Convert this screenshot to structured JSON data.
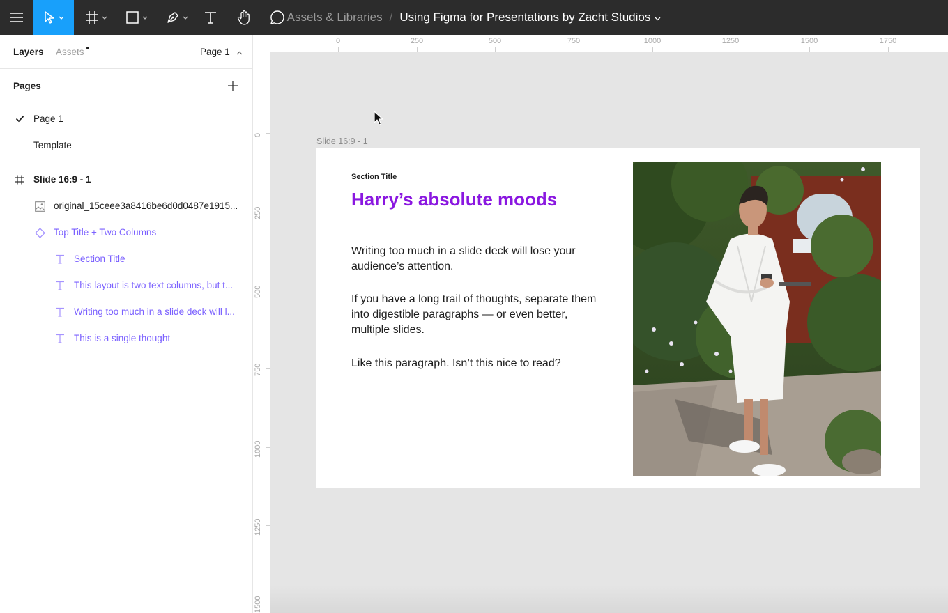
{
  "toolbar": {
    "tools": [
      {
        "name": "main-menu",
        "icon": "hamburger-icon"
      },
      {
        "name": "move-tool",
        "icon": "cursor-icon",
        "active": true
      },
      {
        "name": "frame-tool",
        "icon": "frame-icon"
      },
      {
        "name": "shape-tool",
        "icon": "rectangle-icon"
      },
      {
        "name": "pen-tool",
        "icon": "pen-icon"
      },
      {
        "name": "text-tool",
        "icon": "text-icon"
      },
      {
        "name": "hand-tool",
        "icon": "hand-icon"
      },
      {
        "name": "comment-tool",
        "icon": "comment-icon"
      }
    ],
    "breadcrumb": {
      "parent": "Assets & Libraries",
      "separator": "/",
      "file": "Using Figma for Presentations by Zacht Studios"
    }
  },
  "left_panel": {
    "tabs": {
      "layers": "Layers",
      "assets": "Assets"
    },
    "page_select": "Page 1",
    "pages_title": "Pages",
    "pages": [
      {
        "label": "Page 1",
        "selected": true
      },
      {
        "label": "Template",
        "selected": false
      }
    ],
    "layers": [
      {
        "label": "Slide 16:9 - 1",
        "icon": "frame-icon"
      },
      {
        "label": "original_15ceee3a8416be6d0d0487e1915...",
        "icon": "image-icon"
      },
      {
        "label": "Top Title + Two Columns",
        "icon": "component-instance-icon"
      },
      {
        "label": "Section Title",
        "icon": "text-layer-icon"
      },
      {
        "label": "This layout is two text columns, but t...",
        "icon": "text-layer-icon"
      },
      {
        "label": "Writing too much in a slide deck will l...",
        "icon": "text-layer-icon"
      },
      {
        "label": "This is a single thought",
        "icon": "text-layer-icon"
      }
    ]
  },
  "rulers": {
    "top": [
      "0",
      "250",
      "500",
      "750",
      "1000",
      "1250",
      "1500",
      "1750"
    ],
    "left": [
      "0",
      "250",
      "500",
      "750",
      "1000",
      "1250",
      "1500"
    ]
  },
  "canvas": {
    "frame_label": "Slide 16:9 - 1",
    "slide": {
      "section_title": "Section Title",
      "title": "Harry’s absolute moods",
      "paragraphs": [
        "Writing too much in a slide deck will lose your audience’s attention.",
        "If you have a long trail of thoughts, separate them into digestible paragraphs — or even better, multiple slides.",
        "Like this paragraph. Isn’t this nice to read?"
      ]
    }
  },
  "colors": {
    "toolbar_bg": "#2c2c2c",
    "active_tool": "#18a0fb",
    "accent_purple": "#7b61ff",
    "slide_title": "#8a17e0",
    "canvas_bg": "#e5e5e5"
  }
}
